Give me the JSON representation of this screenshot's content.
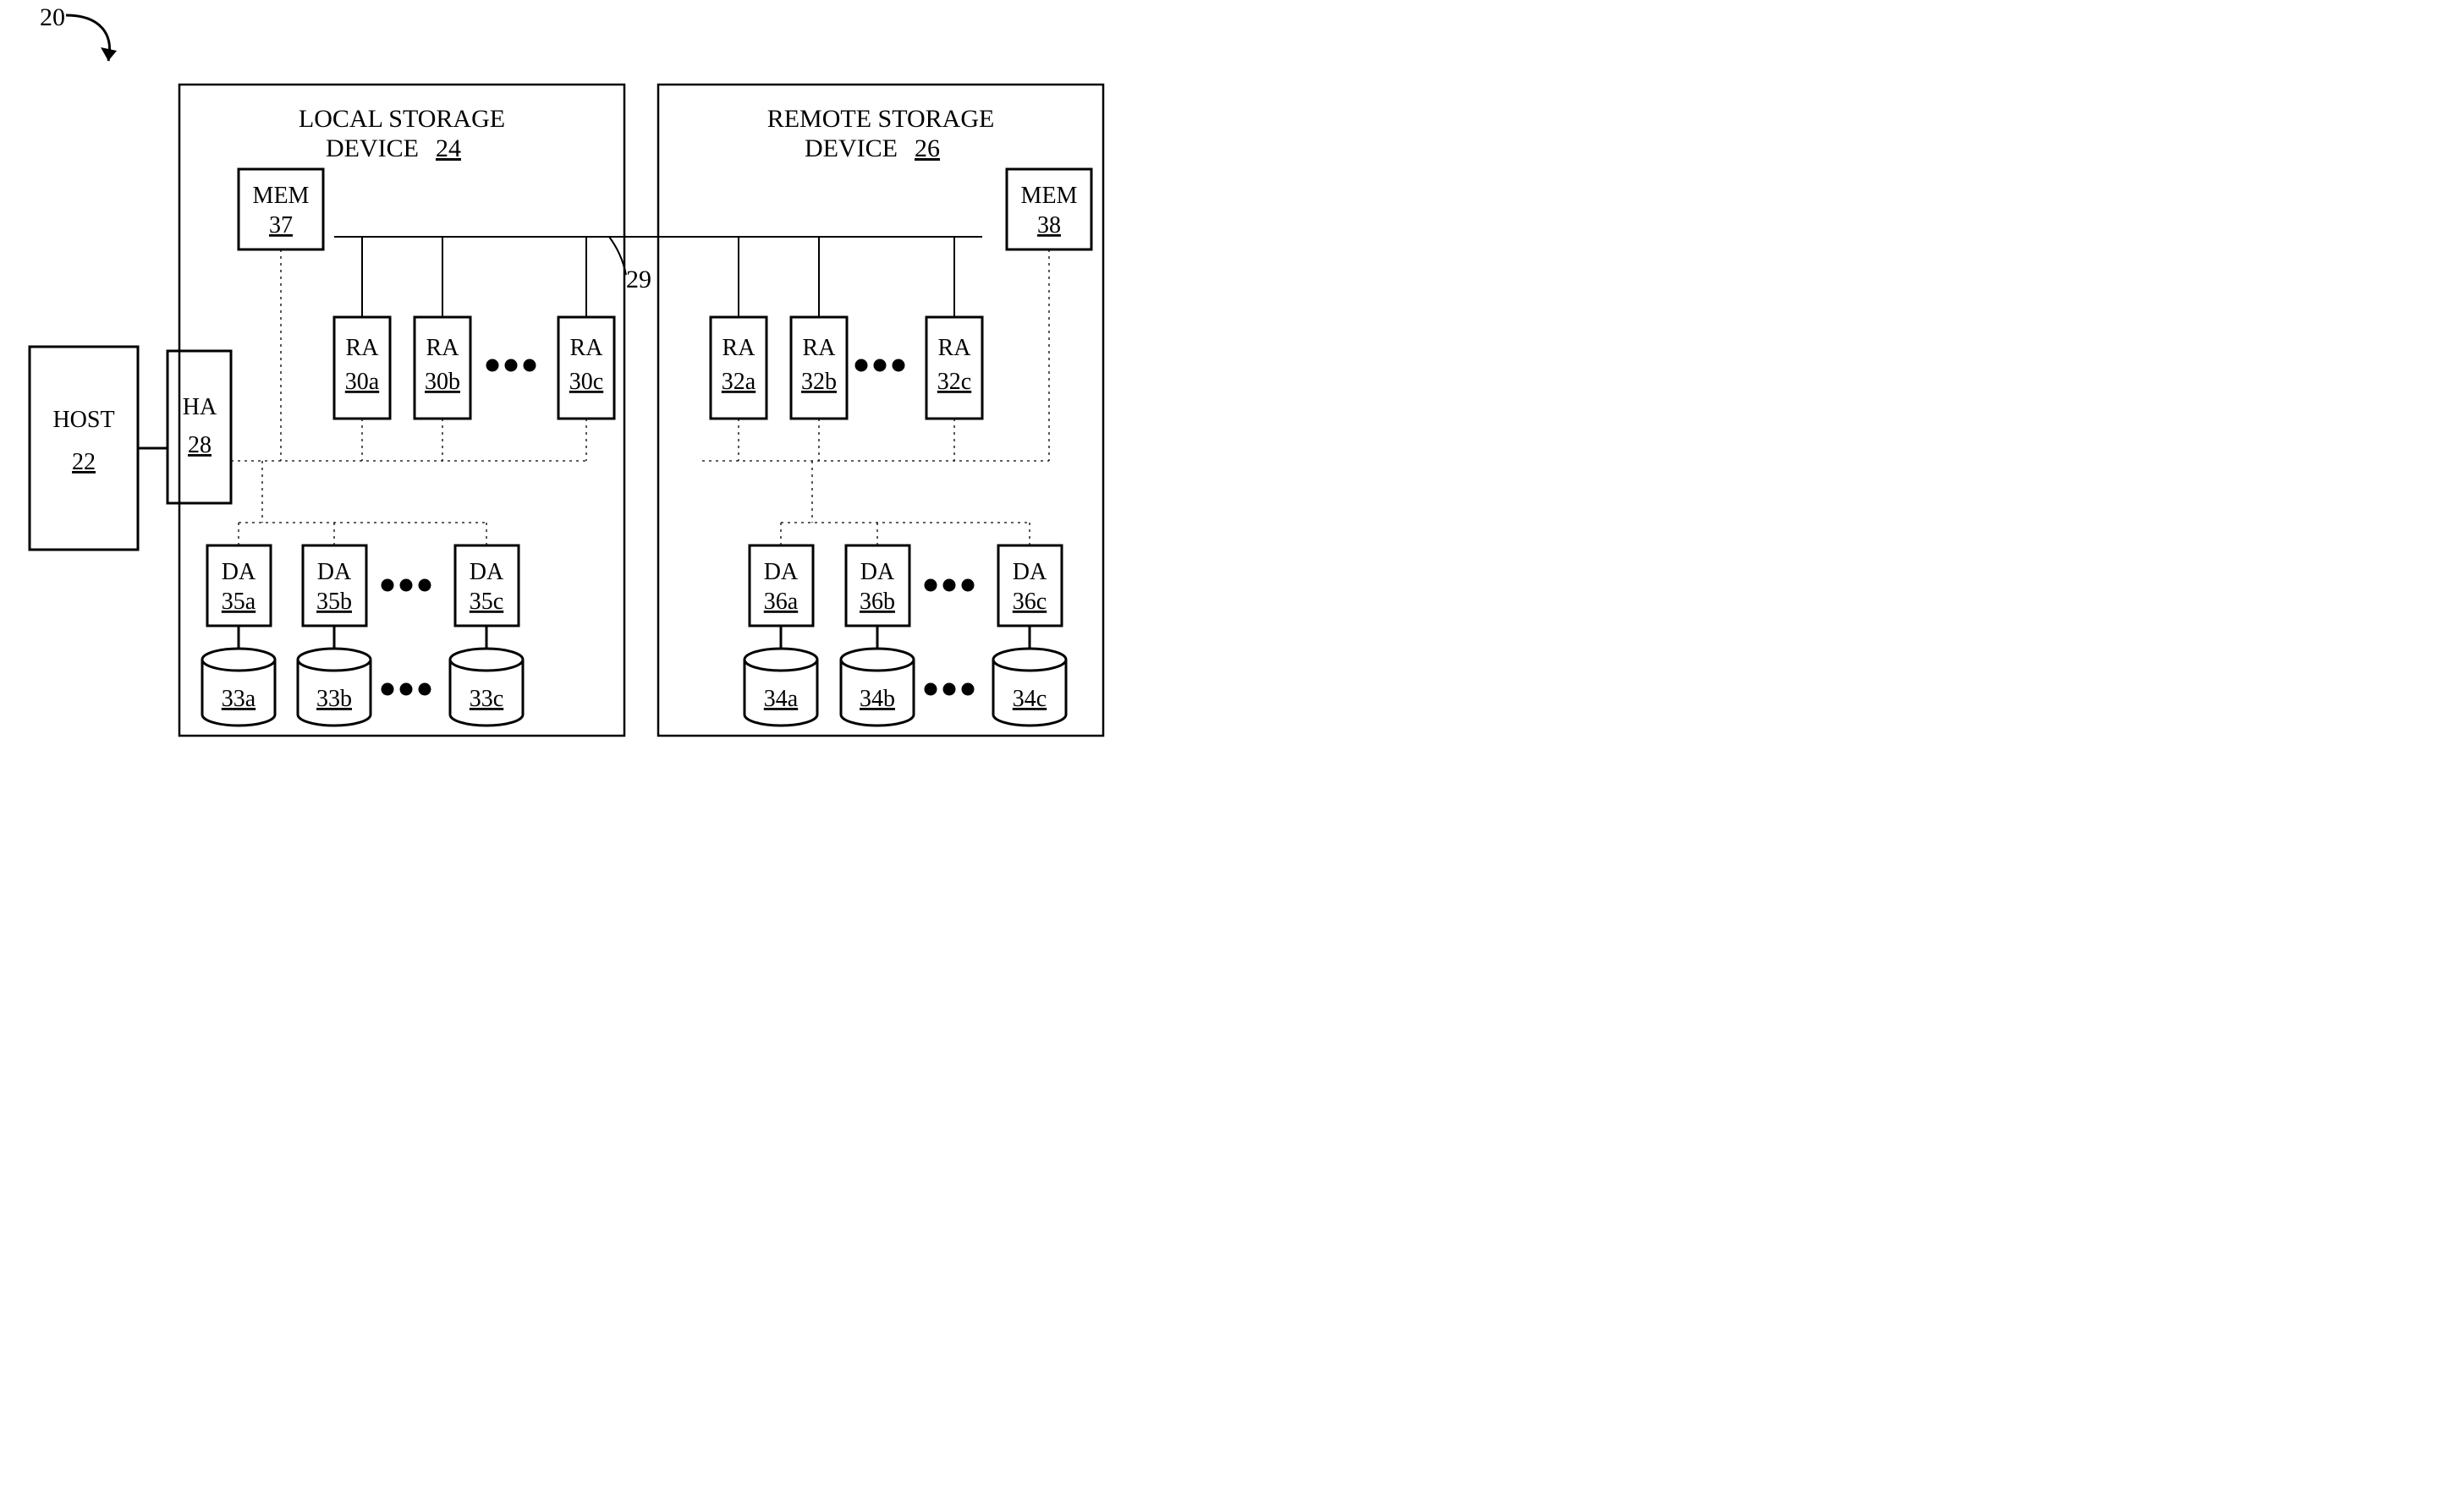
{
  "system_ref": "20",
  "link_ref": "29",
  "host": {
    "label": "HOST",
    "ref": "22"
  },
  "ha": {
    "label": "HA",
    "ref": "28"
  },
  "local": {
    "title1": "LOCAL STORAGE",
    "title2": "DEVICE",
    "ref": "24"
  },
  "remote": {
    "title1": "REMOTE  STORAGE",
    "title2": "DEVICE",
    "ref": "26"
  },
  "mem_local": {
    "label": "MEM",
    "ref": "37"
  },
  "mem_remote": {
    "label": "MEM",
    "ref": "38"
  },
  "ra_local": [
    {
      "label": "RA",
      "ref": "30a"
    },
    {
      "label": "RA",
      "ref": "30b"
    },
    {
      "label": "RA",
      "ref": "30c"
    }
  ],
  "ra_remote": [
    {
      "label": "RA",
      "ref": "32a"
    },
    {
      "label": "RA",
      "ref": "32b"
    },
    {
      "label": "RA",
      "ref": "32c"
    }
  ],
  "da_local": [
    {
      "label": "DA",
      "ref": "35a"
    },
    {
      "label": "DA",
      "ref": "35b"
    },
    {
      "label": "DA",
      "ref": "35c"
    }
  ],
  "da_remote": [
    {
      "label": "DA",
      "ref": "36a"
    },
    {
      "label": "DA",
      "ref": "36b"
    },
    {
      "label": "DA",
      "ref": "36c"
    }
  ],
  "cyl_local": [
    {
      "ref": "33a"
    },
    {
      "ref": "33b"
    },
    {
      "ref": "33c"
    }
  ],
  "cyl_remote": [
    {
      "ref": "34a"
    },
    {
      "ref": "34b"
    },
    {
      "ref": "34c"
    }
  ]
}
